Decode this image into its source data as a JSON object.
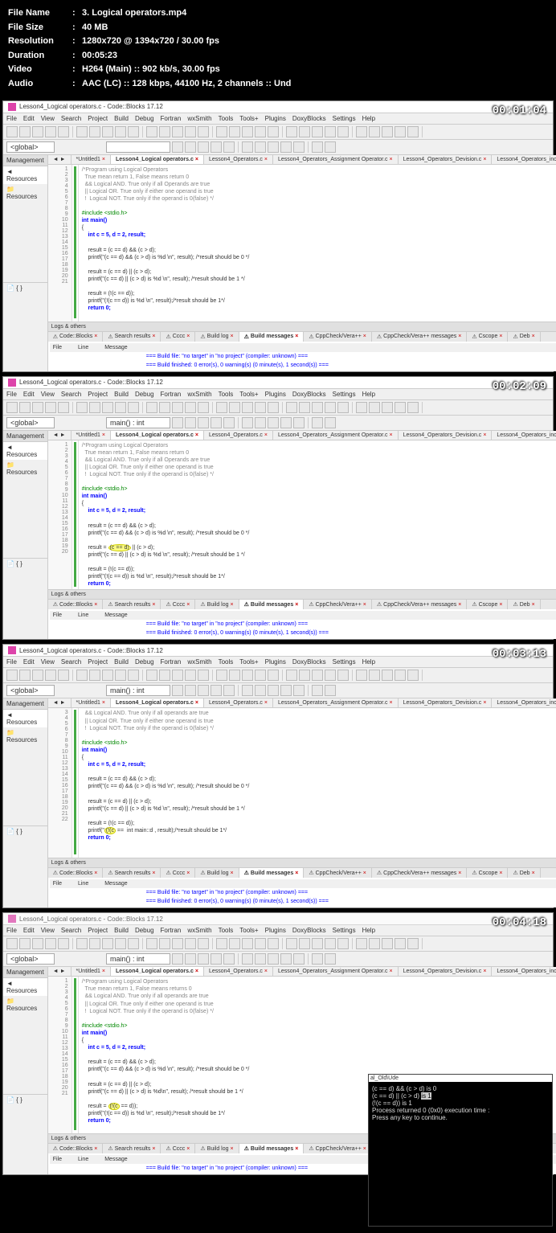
{
  "info": {
    "fileName": {
      "label": "File Name",
      "value": "3. Logical operators.mp4"
    },
    "fileSize": {
      "label": "File Size",
      "value": "40 MB"
    },
    "resolution": {
      "label": "Resolution",
      "value": "1280x720 @ 1394x720 / 30.00 fps"
    },
    "duration": {
      "label": "Duration",
      "value": "00:05:23"
    },
    "video": {
      "label": "Video",
      "value": "H264 (Main) :: 902 kb/s, 30.00 fps"
    },
    "audio": {
      "label": "Audio",
      "value": "AAC (LC) :: 128 kbps, 44100 Hz, 2 channels :: Und"
    }
  },
  "app": {
    "title": "Lesson4_Logical operators.c - Code::Blocks 17.12",
    "menu": [
      "File",
      "Edit",
      "View",
      "Search",
      "Project",
      "Build",
      "Debug",
      "Fortran",
      "wxSmith",
      "Tools",
      "Tools+",
      "Plugins",
      "DoxyBlocks",
      "Settings",
      "Help"
    ],
    "scope_global": "<global>",
    "scope_main": "main() : int",
    "sidebar": {
      "header": "Management",
      "resources_tab": "Resources",
      "resources_item": "Resources"
    },
    "tabs": [
      "*Untitled1",
      "Lesson4_Logical operators.c",
      "Lesson4_Operators.c",
      "Lesson4_Operators_Assignment Operator.c",
      "Lesson4_Operators_Devision.c",
      "Lesson4_Operators_increment_D"
    ],
    "active_tab_index": 1,
    "logs_header": "Logs & others",
    "log_tabs": [
      "Code::Blocks",
      "Search results",
      "Cccc",
      "Build log",
      "Build messages",
      "CppCheck/Vera++",
      "CppCheck/Vera++ messages",
      "Cscope",
      "Deb"
    ],
    "log_active": 4,
    "log_headers": {
      "file": "File",
      "line": "Line",
      "message": "Message"
    }
  },
  "shots": [
    {
      "timestamp": "00:01:04",
      "scope2": "",
      "code_lines": [
        {
          "n": 1,
          "t": "/*Program using Logical Operators",
          "cls": "c-comment"
        },
        {
          "n": 2,
          "t": "  True mean return 1, False means return 0",
          "cls": "c-comment"
        },
        {
          "n": 3,
          "t": "  && Logical AND. True only if all Operands are true",
          "cls": "c-comment"
        },
        {
          "n": 4,
          "t": "  || Logical OR. True only if either one operand is true",
          "cls": "c-comment"
        },
        {
          "n": 5,
          "t": "  !  Logical NOT. True only if the operand is 0(false) */",
          "cls": "c-comment"
        },
        {
          "n": 6,
          "t": "",
          "cls": ""
        },
        {
          "n": 7,
          "t": "#include <stdio.h>",
          "cls": "c-preproc"
        },
        {
          "n": 8,
          "t": "int main()",
          "cls": "c-keyword"
        },
        {
          "n": 9,
          "t": "{",
          "cls": ""
        },
        {
          "n": 10,
          "t": "    int c = 5, d = 2, result;",
          "cls": "c-keyword"
        },
        {
          "n": 11,
          "t": "",
          "cls": ""
        },
        {
          "n": 12,
          "t": "    result = (c == d) && (c > d);",
          "cls": ""
        },
        {
          "n": 13,
          "t": "    printf(\"(c == d) && (c > d) is %d \\n\", result); /*result should be 0 */",
          "cls": ""
        },
        {
          "n": 14,
          "t": "",
          "cls": ""
        },
        {
          "n": 15,
          "t": "    result = (c == d) || (c > d);",
          "cls": ""
        },
        {
          "n": 16,
          "t": "    printf(\"(c == d) || (c > d) is %d \\n\", result); /*result should be 1 */",
          "cls": ""
        },
        {
          "n": 17,
          "t": "",
          "cls": ""
        },
        {
          "n": 18,
          "t": "    result = (!(c == d));",
          "cls": ""
        },
        {
          "n": 19,
          "t": "    printf(\"(!(c == d)) is %d \\n\", result);/*result should be 1*/",
          "cls": ""
        },
        {
          "n": 20,
          "t": "    return 0;",
          "cls": "c-keyword"
        },
        {
          "n": 21,
          "t": "",
          "cls": ""
        }
      ],
      "log_msgs": [
        "=== Build file: \"no target\" in \"no project\" (compiler: unknown) ===",
        "=== Build finished: 0 error(s), 0 warning(s) (0 minute(s), 1 second(s)) ==="
      ]
    },
    {
      "timestamp": "00:02:09",
      "scope2": "main() : int",
      "highlight_line": 15,
      "code_lines": [
        {
          "n": 1,
          "t": "/*Program using Logical Operators",
          "cls": "c-comment"
        },
        {
          "n": 2,
          "t": "  True mean return 1, False means return 0",
          "cls": "c-comment"
        },
        {
          "n": 3,
          "t": "  && Logical AND. True only if all Operands are true",
          "cls": "c-comment"
        },
        {
          "n": 4,
          "t": "  || Logical OR. True only if either one operand is true",
          "cls": "c-comment"
        },
        {
          "n": 5,
          "t": "  !  Logical NOT. True only if the operand is 0(false) */",
          "cls": "c-comment"
        },
        {
          "n": 6,
          "t": "",
          "cls": ""
        },
        {
          "n": 7,
          "t": "#include <stdio.h>",
          "cls": "c-preproc"
        },
        {
          "n": 8,
          "t": "int main()",
          "cls": "c-keyword"
        },
        {
          "n": 9,
          "t": "{",
          "cls": ""
        },
        {
          "n": 10,
          "t": "    int c = 5, d = 2, result;",
          "cls": "c-keyword"
        },
        {
          "n": 11,
          "t": "",
          "cls": ""
        },
        {
          "n": 12,
          "t": "    result = (c == d) && (c > d);",
          "cls": ""
        },
        {
          "n": 13,
          "t": "    printf(\"(c == d) && (c > d) is %d \\n\", result); /*result should be 0 */",
          "cls": ""
        },
        {
          "n": 14,
          "t": "",
          "cls": ""
        },
        {
          "n": 15,
          "t": "    result = (c == d) || (c > d);",
          "cls": ""
        },
        {
          "n": 16,
          "t": "    printf(\"(c == d) || (c > d) is %d \\n\", result); /*result should be 1 */",
          "cls": ""
        },
        {
          "n": 17,
          "t": "",
          "cls": ""
        },
        {
          "n": 18,
          "t": "    result = (!(c == d));",
          "cls": ""
        },
        {
          "n": 19,
          "t": "    printf(\"(!(c == d)) is %d \\n\", result);/*result should be 1*/",
          "cls": ""
        },
        {
          "n": 20,
          "t": "    return 0;",
          "cls": "c-keyword"
        }
      ],
      "log_msgs": [
        "=== Build file: \"no target\" in \"no project\" (compiler: unknown) ===",
        "=== Build finished: 0 error(s), 0 warning(s) (0 minute(s), 1 second(s)) ==="
      ]
    },
    {
      "timestamp": "00:03:13",
      "scope2": "main() : int",
      "highlight_line": 19,
      "code_lines": [
        {
          "n": 3,
          "t": "  && Logical AND. True only if all operands are true",
          "cls": "c-comment"
        },
        {
          "n": 4,
          "t": "  || Logical OR. True only if either one operand is true",
          "cls": "c-comment"
        },
        {
          "n": 5,
          "t": "  !  Logical NOT. True only if the operand is 0(false) */",
          "cls": "c-comment"
        },
        {
          "n": 6,
          "t": "",
          "cls": ""
        },
        {
          "n": 7,
          "t": "#include <stdio.h>",
          "cls": "c-preproc"
        },
        {
          "n": 8,
          "t": "int main()",
          "cls": "c-keyword"
        },
        {
          "n": 9,
          "t": "{",
          "cls": ""
        },
        {
          "n": 10,
          "t": "    int c = 5, d = 2, result;",
          "cls": "c-keyword"
        },
        {
          "n": 11,
          "t": "",
          "cls": ""
        },
        {
          "n": 12,
          "t": "    result = (c == d) && (c > d);",
          "cls": ""
        },
        {
          "n": 13,
          "t": "    printf(\"(c == d) && (c > d) is %d \\n\", result); /*result should be 0 */",
          "cls": ""
        },
        {
          "n": 14,
          "t": "",
          "cls": ""
        },
        {
          "n": 15,
          "t": "    result = (c == d) || (c > d);",
          "cls": ""
        },
        {
          "n": 16,
          "t": "    printf(\"(c == d) || (c > d) is %d \\n\", result); /*result should be 1 */",
          "cls": ""
        },
        {
          "n": 17,
          "t": "",
          "cls": ""
        },
        {
          "n": 18,
          "t": "    result = (!(c == d));",
          "cls": ""
        },
        {
          "n": 19,
          "t": "    printf(\"(!(c ==  int main::d , result);/*result should be 1*/",
          "cls": ""
        },
        {
          "n": 20,
          "t": "    return 0;",
          "cls": "c-keyword"
        },
        {
          "n": 21,
          "t": "",
          "cls": ""
        },
        {
          "n": 22,
          "t": "",
          "cls": ""
        }
      ],
      "log_msgs": [
        "=== Build file: \"no target\" in \"no project\" (compiler: unknown) ===",
        "=== Build finished: 0 error(s), 0 warning(s) (0 minute(s), 1 second(s)) ==="
      ]
    },
    {
      "timestamp": "00:04:18",
      "scope2": "main() : int",
      "title_alt": "Lesson4_Logical operators.c - Code::Blocks 17.12",
      "dim_title": true,
      "highlight_line": 18,
      "code_lines": [
        {
          "n": 1,
          "t": "/*Program using Logical Operators",
          "cls": "c-comment"
        },
        {
          "n": 2,
          "t": "  True mean return 1, False means returns 0",
          "cls": "c-comment"
        },
        {
          "n": 3,
          "t": "  && Logical AND. True only if all operands are true",
          "cls": "c-comment"
        },
        {
          "n": 4,
          "t": "  || Logical OR. True only if either one operand is true",
          "cls": "c-comment"
        },
        {
          "n": 5,
          "t": "  !  Logical NOT. True only if the operand is 0(false) */",
          "cls": "c-comment"
        },
        {
          "n": 6,
          "t": "",
          "cls": ""
        },
        {
          "n": 7,
          "t": "#include <stdio.h>",
          "cls": "c-preproc"
        },
        {
          "n": 8,
          "t": "int main()",
          "cls": "c-keyword"
        },
        {
          "n": 9,
          "t": "{",
          "cls": ""
        },
        {
          "n": 10,
          "t": "    int c = 5, d = 2, result;",
          "cls": "c-keyword"
        },
        {
          "n": 11,
          "t": "",
          "cls": ""
        },
        {
          "n": 12,
          "t": "    result = (c == d) && (c > d);",
          "cls": ""
        },
        {
          "n": 13,
          "t": "    printf(\"(c == d) && (c > d) is %d \\n\", result); /*result should be 0 */",
          "cls": ""
        },
        {
          "n": 14,
          "t": "",
          "cls": ""
        },
        {
          "n": 15,
          "t": "    result = (c == d) || (c > d);",
          "cls": ""
        },
        {
          "n": 16,
          "t": "    printf(\"(c == d) || (c > d) is %d\\n\", result); /*result should be 1 */",
          "cls": ""
        },
        {
          "n": 17,
          "t": "",
          "cls": ""
        },
        {
          "n": 18,
          "t": "    result = (!(c == d));",
          "cls": ""
        },
        {
          "n": 19,
          "t": "    printf(\"(!(c == d)) is %d \\n\", result);/*result should be 1*/",
          "cls": ""
        },
        {
          "n": 20,
          "t": "    return 0;",
          "cls": "c-keyword"
        },
        {
          "n": 21,
          "t": "",
          "cls": ""
        }
      ],
      "log_msgs": [
        "=== Build file: \"no target\" in \"no project\" (compiler: unknown) ==="
      ],
      "console": {
        "lines": [
          "(c == d) && (c > d) is 0",
          "(c == d) || (c > d) is 1",
          "(!(c == d)) is 1",
          "",
          "Process returned 0 (0x0)   execution time :",
          "Press any key to continue."
        ],
        "highlight_text": "is 1",
        "title_suffix": "al_Old\\Ude"
      }
    }
  ]
}
